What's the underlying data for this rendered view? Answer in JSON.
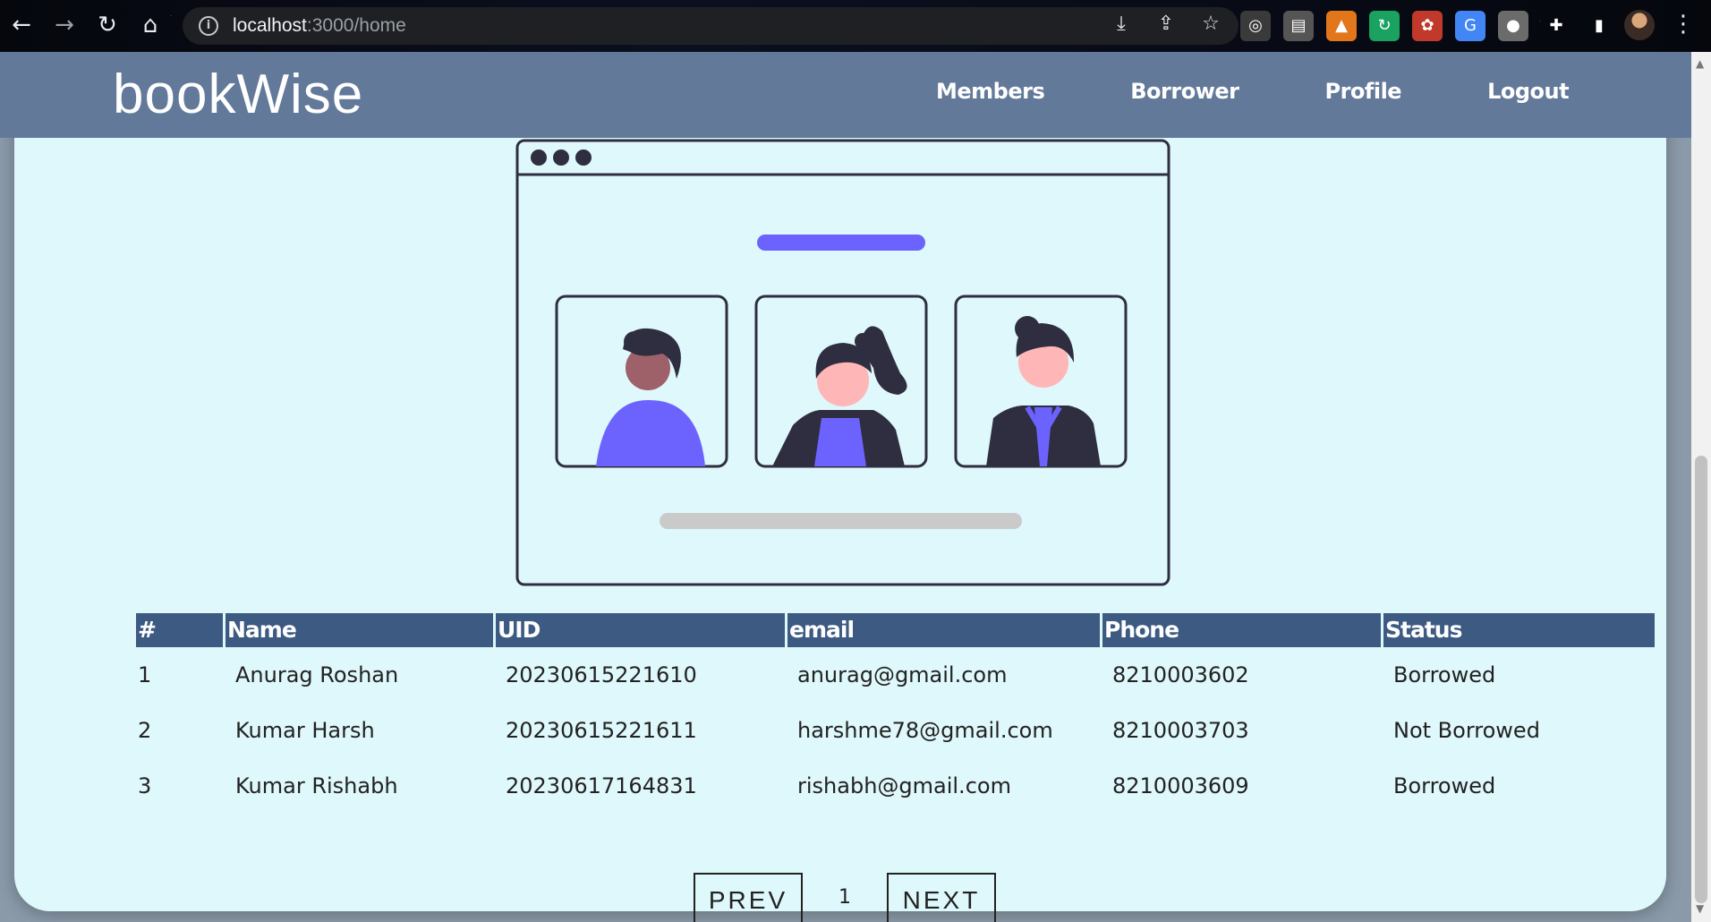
{
  "browser": {
    "url_host": "localhost",
    "url_path": ":3000/home",
    "nav_icons": [
      "back-arrow-icon",
      "forward-arrow-icon",
      "reload-icon",
      "home-icon"
    ],
    "omnibox_icons": [
      "install-icon",
      "share-icon",
      "star-icon"
    ],
    "extensions": [
      {
        "name": "ext-glasses-icon",
        "color": "#3a3a3a",
        "glyph": "◎"
      },
      {
        "name": "ext-doc-icon",
        "color": "#555",
        "glyph": "▤"
      },
      {
        "name": "metamask-fox-icon",
        "color": "#e2761b",
        "glyph": "▲"
      },
      {
        "name": "ext-green-icon",
        "color": "#1aa260",
        "glyph": "↻"
      },
      {
        "name": "ext-red-icon",
        "color": "#c0392b",
        "glyph": "✿"
      },
      {
        "name": "google-translate-icon",
        "color": "#4285f4",
        "glyph": "G"
      },
      {
        "name": "ext-gray-icon",
        "color": "#6b6b6b",
        "glyph": "●"
      },
      {
        "name": "puzzle-extensions-icon",
        "color": "transparent",
        "glyph": "✚"
      },
      {
        "name": "side-panel-icon",
        "color": "transparent",
        "glyph": "▮"
      }
    ]
  },
  "navbar": {
    "brand": "bookWise",
    "links": [
      "Members",
      "Borrower",
      "Profile",
      "Logout"
    ]
  },
  "colors": {
    "navbar_bg": "#62799a",
    "page_bg": "#dff8fb",
    "table_header_bg": "#3c5a82",
    "accent_purple": "#6c63ff"
  },
  "table": {
    "headers": [
      "#",
      "Name",
      "UID",
      "email",
      "Phone",
      "Status"
    ],
    "rows": [
      [
        "1",
        "Anurag Roshan",
        "20230615221610",
        "anurag@gmail.com",
        "8210003602",
        "Borrowed"
      ],
      [
        "2",
        "Kumar Harsh",
        "20230615221611",
        "harshme78@gmail.com",
        "8210003703",
        "Not Borrowed"
      ],
      [
        "3",
        "Kumar Rishabh",
        "20230617164831",
        "rishabh@gmail.com",
        "8210003609",
        "Borrowed"
      ]
    ]
  },
  "pagination": {
    "prev_label": "PREV",
    "page": "1",
    "next_label": "NEXT"
  }
}
